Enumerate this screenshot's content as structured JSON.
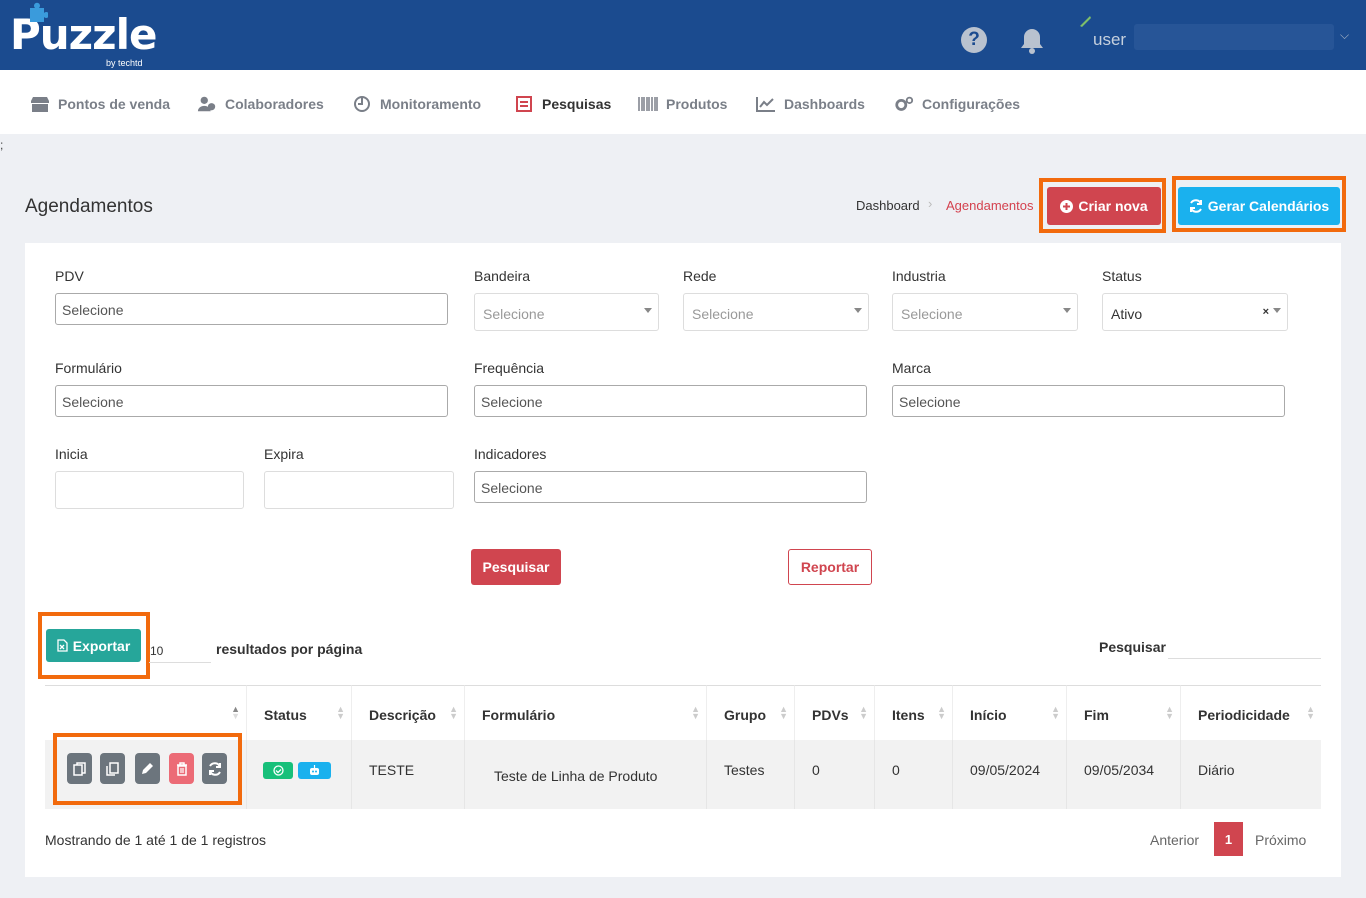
{
  "header": {
    "logo_text": "Puzzle",
    "logo_sub": "by techtd",
    "user_label": "user"
  },
  "nav": {
    "items": [
      {
        "label": "Pontos de venda",
        "icon": "store-icon"
      },
      {
        "label": "Colaboradores",
        "icon": "users-icon"
      },
      {
        "label": "Monitoramento",
        "icon": "monitor-icon"
      },
      {
        "label": "Pesquisas",
        "icon": "survey-icon"
      },
      {
        "label": "Produtos",
        "icon": "barcode-icon"
      },
      {
        "label": "Dashboards",
        "icon": "chart-icon"
      },
      {
        "label": "Configurações",
        "icon": "cogs-icon"
      }
    ],
    "active": "Pesquisas"
  },
  "page": {
    "stray": ";",
    "title": "Agendamentos",
    "breadcrumb": {
      "home": "Dashboard",
      "current": "Agendamentos"
    },
    "btn_criar": "Criar nova",
    "btn_gerar": "Gerar Calendários"
  },
  "filters": {
    "pdv": {
      "label": "PDV",
      "value": "Selecione"
    },
    "bandeira": {
      "label": "Bandeira",
      "value": "Selecione"
    },
    "rede": {
      "label": "Rede",
      "value": "Selecione"
    },
    "industria": {
      "label": "Industria",
      "value": "Selecione"
    },
    "status": {
      "label": "Status",
      "value": "Ativo"
    },
    "formulario": {
      "label": "Formulário",
      "value": "Selecione"
    },
    "frequencia": {
      "label": "Frequência",
      "value": "Selecione"
    },
    "marca": {
      "label": "Marca",
      "value": "Selecione"
    },
    "inicia": {
      "label": "Inicia",
      "value": ""
    },
    "expira": {
      "label": "Expira",
      "value": ""
    },
    "indicadores": {
      "label": "Indicadores",
      "value": "Selecione"
    },
    "btn_pesquisar": "Pesquisar",
    "btn_reportar": "Reportar"
  },
  "table_controls": {
    "btn_exportar": "Exportar",
    "per_page_value": "10",
    "per_page_label": "resultados por página",
    "search_label": "Pesquisar"
  },
  "table": {
    "columns": [
      "",
      "Status",
      "Descrição",
      "Formulário",
      "Grupo",
      "PDVs",
      "Itens",
      "Início",
      "Fim",
      "Periodicidade"
    ],
    "rows": [
      {
        "descricao": "TESTE",
        "formulario": "Teste de Linha de Produto",
        "grupo": "Testes",
        "pdvs": "0",
        "itens": "0",
        "inicio": "09/05/2024",
        "fim": "09/05/2034",
        "periodicidade": "Diário"
      }
    ]
  },
  "footer": {
    "showing": "Mostrando de 1 até 1 de 1 registros",
    "prev": "Anterior",
    "page": "1",
    "next": "Próximo"
  },
  "colors": {
    "header_bg": "#1b4b8f",
    "primary_red": "#d0454f",
    "accent_blue": "#1ab1ee",
    "export_green": "#26a69a",
    "highlight_orange": "#f26a0d"
  }
}
